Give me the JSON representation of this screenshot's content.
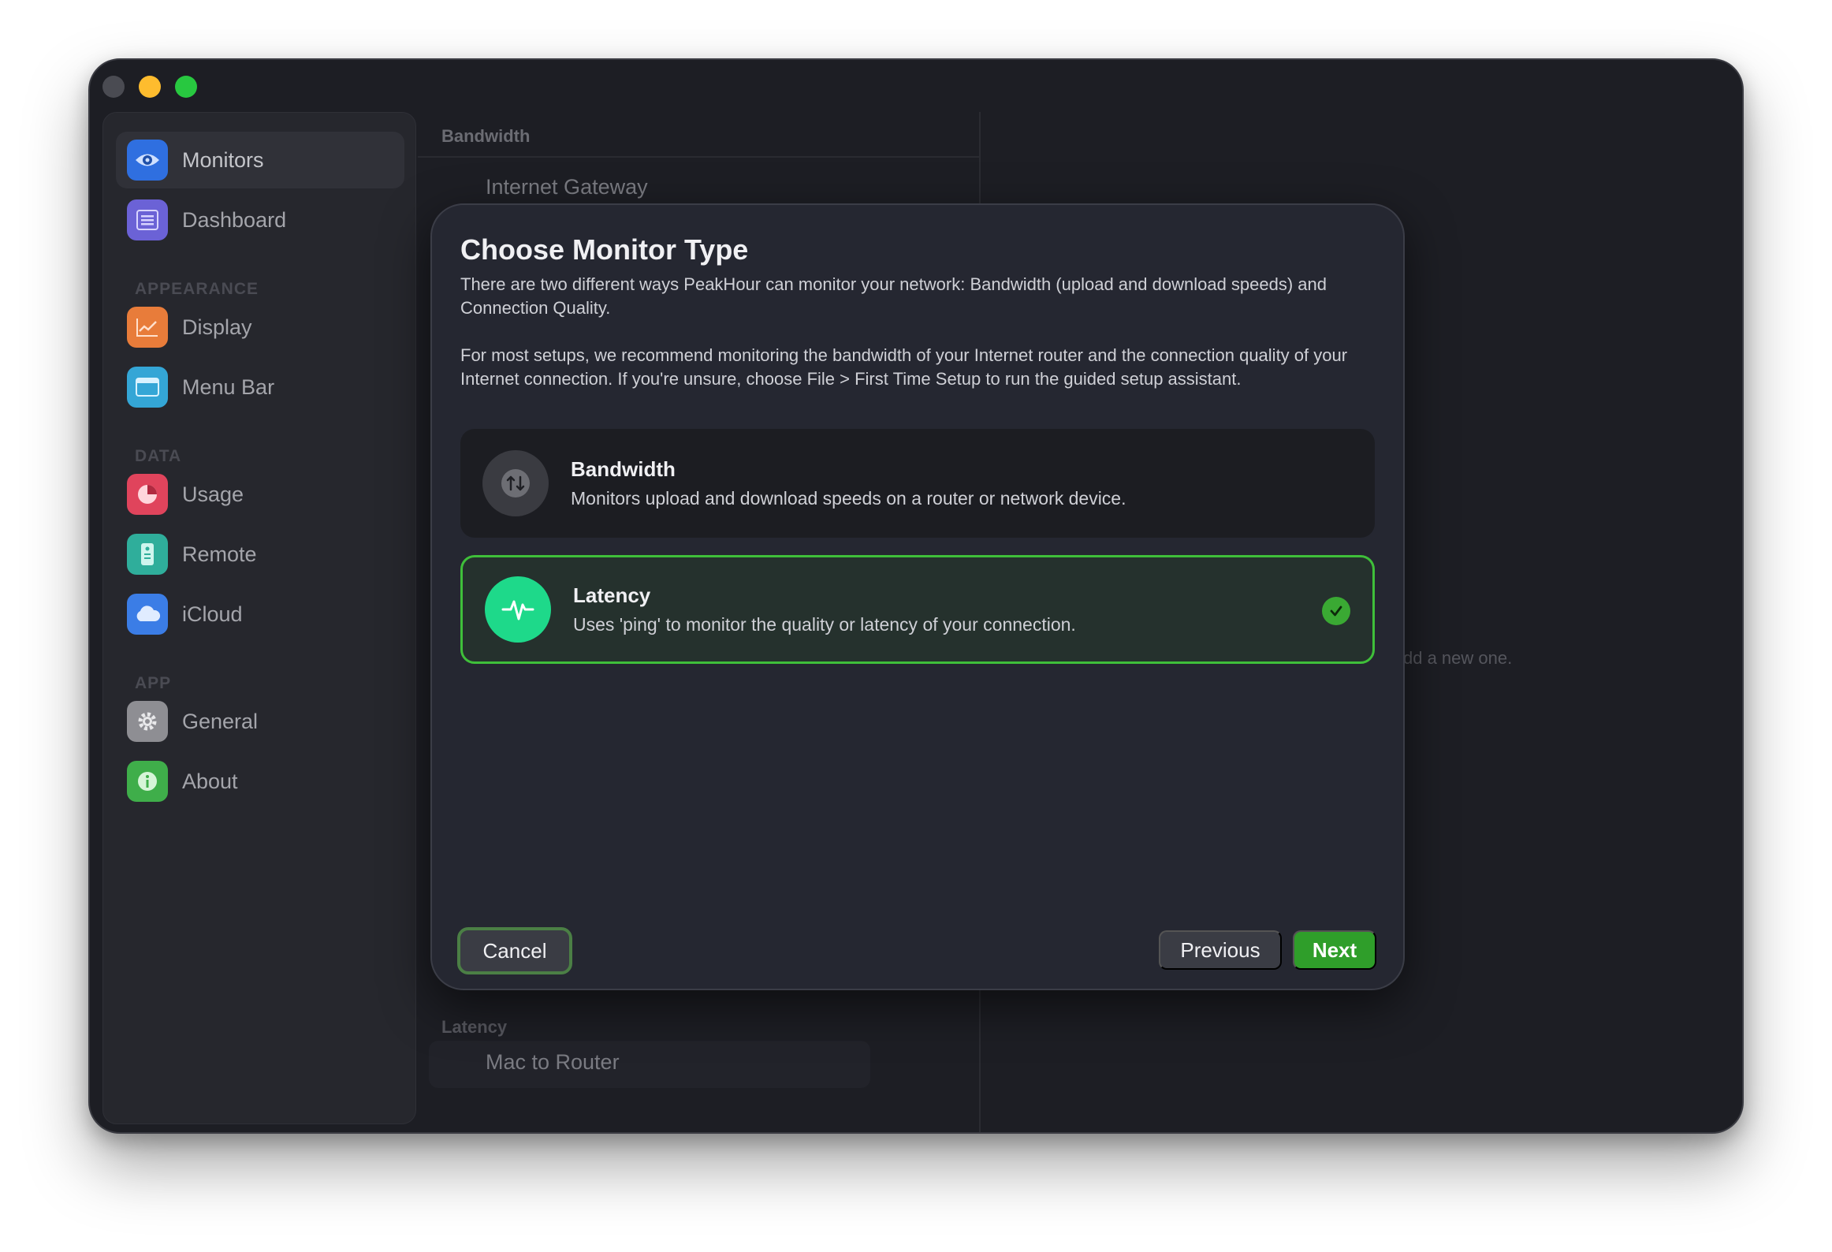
{
  "sidebar": {
    "sections": {
      "appearance": "APPEARANCE",
      "data": "DATA",
      "app": "APP"
    },
    "items": [
      {
        "label": "Monitors",
        "icon": "eye-icon",
        "color": "#2f6fe0"
      },
      {
        "label": "Dashboard",
        "icon": "list-icon",
        "color": "#6b62d6"
      },
      {
        "label": "Display",
        "icon": "chart-icon",
        "color": "#e87c3a"
      },
      {
        "label": "Menu Bar",
        "icon": "window-icon",
        "color": "#34a6d6"
      },
      {
        "label": "Usage",
        "icon": "pie-icon",
        "color": "#e0445c"
      },
      {
        "label": "Remote",
        "icon": "remote-icon",
        "color": "#2fae9b"
      },
      {
        "label": "iCloud",
        "icon": "cloud-icon",
        "color": "#3b7de6"
      },
      {
        "label": "General",
        "icon": "gear-icon",
        "color": "#8e8e93"
      },
      {
        "label": "About",
        "icon": "info-icon",
        "color": "#3fae4a"
      }
    ]
  },
  "middle": {
    "bandwidth_header": "Bandwidth",
    "bandwidth_row": "Internet Gateway",
    "latency_header": "Latency",
    "latency_row": "Mac to Router",
    "add": "+",
    "remove": "–",
    "empty_hint": "dd a new one."
  },
  "modal": {
    "title": "Choose Monitor Type",
    "para1": "There are two different ways PeakHour can monitor your network: Bandwidth (upload and download speeds) and Connection Quality.",
    "para2": "For most setups, we recommend monitoring the bandwidth of your Internet router and the connection quality of your Internet connection. If you're unsure, choose File > First Time Setup to run the guided setup assistant.",
    "options": {
      "bandwidth": {
        "title": "Bandwidth",
        "desc": "Monitors upload and download speeds on a router or network device."
      },
      "latency": {
        "title": "Latency",
        "desc": "Uses 'ping' to monitor the quality or latency of your connection.",
        "selected": true
      }
    },
    "buttons": {
      "cancel": "Cancel",
      "previous": "Previous",
      "next": "Next"
    }
  },
  "colors": {
    "accent_green": "#2f9e2a",
    "selection_border": "#3fbf3a",
    "latency_icon": "#1ed98a"
  }
}
